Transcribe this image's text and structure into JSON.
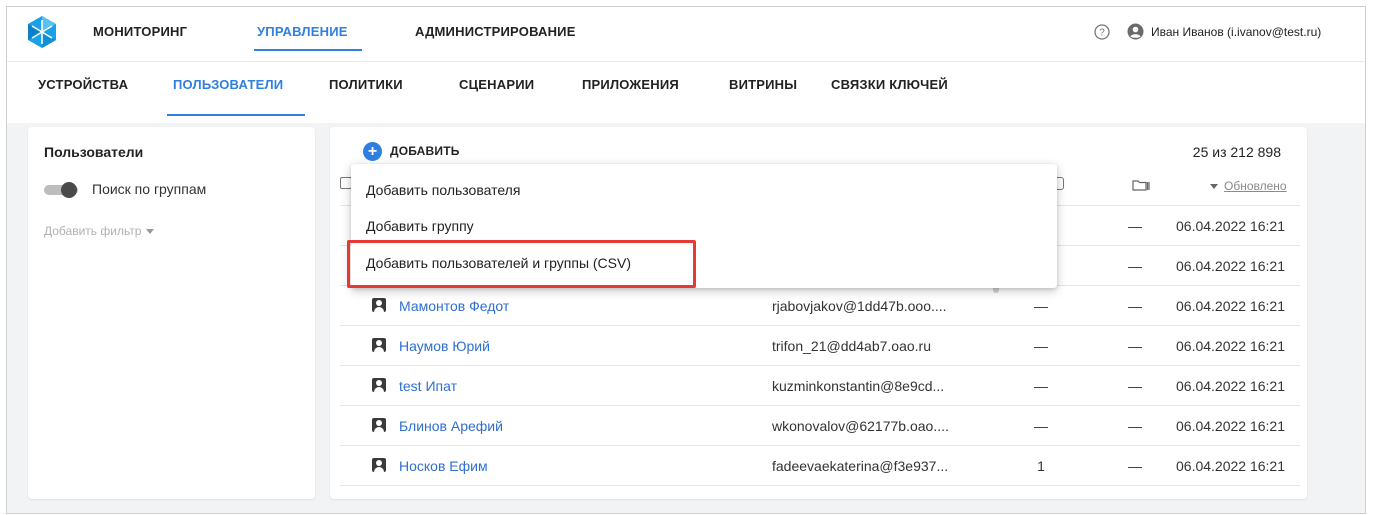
{
  "header": {
    "nav": [
      {
        "label": "МОНИТОРИНГ",
        "active": false
      },
      {
        "label": "УПРАВЛЕНИЕ",
        "active": true
      },
      {
        "label": "АДМИНИСТРИРОВАНИЕ",
        "active": false
      }
    ],
    "help_icon": "help-circle-icon",
    "user_icon": "account-circle-icon",
    "user_name": "Иван Иванов (i.ivanov@test.ru)"
  },
  "subnav": [
    {
      "label": "УСТРОЙСТВА",
      "active": false
    },
    {
      "label": "ПОЛЬЗОВАТЕЛИ",
      "active": true
    },
    {
      "label": "ПОЛИТИКИ",
      "active": false
    },
    {
      "label": "СЦЕНАРИИ",
      "active": false
    },
    {
      "label": "ПРИЛОЖЕНИЯ",
      "active": false
    },
    {
      "label": "ВИТРИНЫ",
      "active": false
    },
    {
      "label": "СВЯЗКИ КЛЮЧЕЙ",
      "active": false
    }
  ],
  "sidebar": {
    "title": "Пользователи",
    "toggle_label": "Поиск по группам",
    "toggle_on": false,
    "add_filter_label": "Добавить фильтр"
  },
  "main": {
    "add_button_label": "ДОБАВИТЬ",
    "count_label": "25 из 212 898",
    "sort_label": "Обновлено",
    "rows": [
      {
        "name": "Мамонтов Федот",
        "email": "rjabovjakov@1dd47b.ooo....",
        "c1": "—",
        "c2": "—",
        "date": "06.04.2022 16:21"
      },
      {
        "name": "Наумов Юрий",
        "email": "trifon_21@dd4ab7.oao.ru",
        "c1": "—",
        "c2": "—",
        "date": "06.04.2022 16:21"
      },
      {
        "name": "test Ипат",
        "email": "kuzminkonstantin@8e9cd...",
        "c1": "—",
        "c2": "—",
        "date": "06.04.2022 16:21"
      },
      {
        "name": "Блинов Арефий",
        "email": "wkonovalov@62177b.oao....",
        "c1": "—",
        "c2": "—",
        "date": "06.04.2022 16:21"
      },
      {
        "name": "Носков Ефим",
        "email": "fadeevaekaterina@f3e937...",
        "c1": "1",
        "c2": "—",
        "date": "06.04.2022 16:21"
      }
    ],
    "hidden_rows": [
      {
        "c1": "-",
        "c2": "—",
        "date": "06.04.2022 16:21"
      },
      {
        "c1": "-",
        "c2": "—",
        "date": "06.04.2022 16:21"
      }
    ]
  },
  "dropdown": {
    "items": [
      "Добавить пользователя",
      "Добавить группу",
      "Добавить пользователей и группы (CSV)"
    ],
    "highlight_color": "#e53935"
  },
  "colors": {
    "accent": "#2f7fe0",
    "link": "#2f6fd0",
    "highlight": "#e53935"
  }
}
